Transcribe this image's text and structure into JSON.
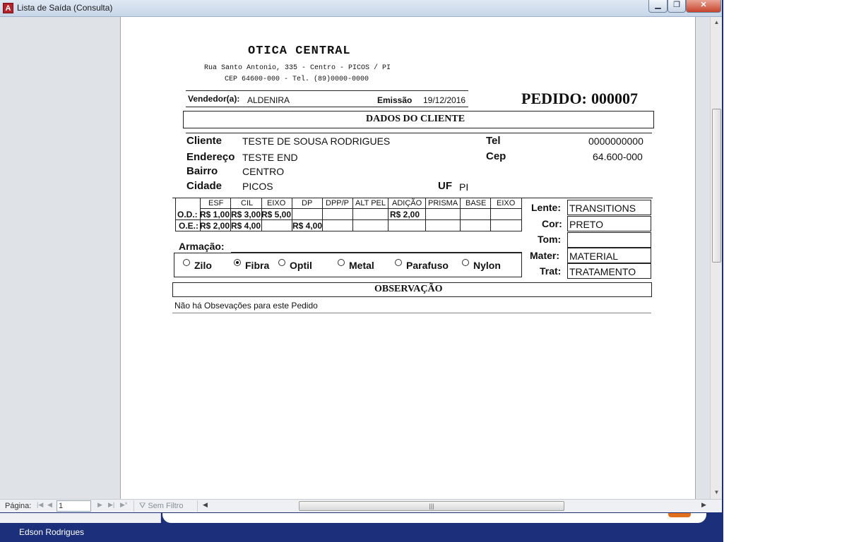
{
  "window": {
    "title": "Lista de Saída (Consulta)",
    "app_icon": "A"
  },
  "report": {
    "company": "OTICA CENTRAL",
    "address_line1": "Rua Santo Antonio, 335 - Centro - PICOS / PI",
    "address_line2": "CEP 64600-000 - Tel.  (89)0000-0000",
    "vendedor_label": "Vendedor(a):",
    "vendedor_value": "ALDENIRA",
    "emissao_label": "Emissão",
    "emissao_value": "19/12/2016",
    "pedido_label": "PEDIDO:",
    "pedido_value": "000007",
    "section_cliente": "DADOS DO CLIENTE",
    "cliente_label": "Cliente",
    "cliente_value": "TESTE DE SOUSA RODRIGUES",
    "tel_label": "Tel",
    "tel_value": "0000000000",
    "endereco_label": "Endereço",
    "endereco_value": "TESTE END",
    "cep_label": "Cep",
    "cep_value": "64.600-000",
    "bairro_label": "Bairro",
    "bairro_value": "CENTRO",
    "cidade_label": "Cidade",
    "cidade_value": "PICOS",
    "uf_label": "UF",
    "uf_value": "PI",
    "rx_headers": [
      "ESF",
      "CIL",
      "EIXO",
      "DP",
      "DPP/P",
      "ALT PEL",
      "ADIÇÃO",
      "PRISMA",
      "BASE",
      "EIXO"
    ],
    "rx_rows": [
      {
        "label": "O.D.:",
        "cells": [
          "R$ 1,00",
          "R$ 3,00",
          "R$ 5,00",
          "",
          "",
          "",
          "R$ 2,00",
          "",
          "",
          ""
        ]
      },
      {
        "label": "O.E.:",
        "cells": [
          "R$ 2,00",
          "R$ 4,00",
          "",
          "R$ 4,00",
          "",
          "",
          "",
          "",
          "",
          ""
        ]
      }
    ],
    "lens": {
      "lente_label": "Lente:",
      "lente_value": "TRANSITIONS",
      "cor_label": "Cor:",
      "cor_value": "PRETO",
      "tom_label": "Tom:",
      "tom_value": "",
      "mater_label": "Mater:",
      "mater_value": "MATERIAL",
      "trat_label": "Trat:",
      "trat_value": "TRATAMENTO"
    },
    "armacao_label": "Armação:",
    "armacao_options": [
      "Zilo",
      "Fibra",
      "Optil",
      "Metal",
      "Parafuso",
      "Nylon"
    ],
    "armacao_selected": "Fibra",
    "section_obs": "OBSERVAÇÃO",
    "obs_text": "Não há Obsevações para este Pedido"
  },
  "nav": {
    "pagina_label": "Página:",
    "page_value": "1",
    "filter_label": "Sem Filtro",
    "first_icon": "first-record-icon",
    "prev_icon": "prev-record-icon",
    "next_icon": "next-record-icon",
    "last_icon": "last-record-icon"
  },
  "status": {
    "user": "Edson Rodrigues"
  }
}
